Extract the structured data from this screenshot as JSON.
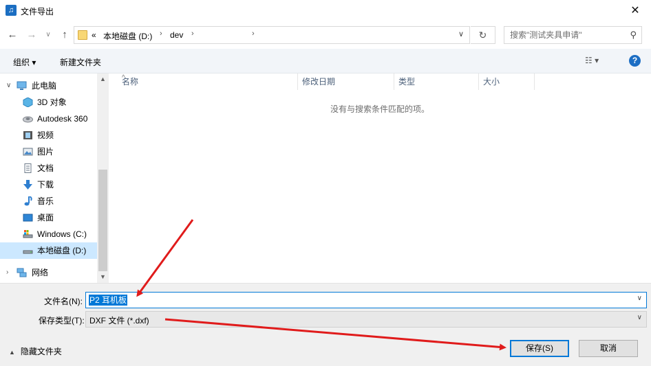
{
  "window": {
    "title": "文件导出",
    "close_glyph": "✕"
  },
  "nav": {
    "back": "←",
    "forward": "→",
    "recent": "∨",
    "up": "↑",
    "breadcrumb": [
      {
        "label": "«"
      },
      {
        "label": "本地磁盘 (D:)"
      },
      {
        "label": "dev"
      }
    ],
    "separator": "›",
    "refresh": "↻",
    "search_placeholder": "搜索\"测试夹具申请\""
  },
  "toolbar": {
    "organize": "组织 ▾",
    "new_folder": "新建文件夹",
    "view": "☷ ▾",
    "help": "?"
  },
  "sidebar": {
    "items": [
      {
        "label": "此电脑",
        "icon": "this-pc-icon"
      },
      {
        "label": "3D 对象",
        "icon": "3d-objects-icon"
      },
      {
        "label": "Autodesk 360",
        "icon": "autodesk-360-icon"
      },
      {
        "label": "视频",
        "icon": "videos-icon"
      },
      {
        "label": "图片",
        "icon": "pictures-icon"
      },
      {
        "label": "文档",
        "icon": "documents-icon"
      },
      {
        "label": "下载",
        "icon": "downloads-icon"
      },
      {
        "label": "音乐",
        "icon": "music-icon"
      },
      {
        "label": "桌面",
        "icon": "desktop-icon"
      },
      {
        "label": "Windows (C:)",
        "icon": "drive-c-icon"
      },
      {
        "label": "本地磁盘 (D:)",
        "icon": "drive-d-icon",
        "selected": true
      },
      {
        "label": "网络",
        "icon": "network-icon"
      }
    ]
  },
  "filelist": {
    "columns": [
      "名称",
      "修改日期",
      "类型",
      "大小"
    ],
    "empty_message": "没有与搜索条件匹配的项。"
  },
  "form": {
    "filename_label": "文件名(N):",
    "filename_value": "P2 耳机板",
    "filetype_label": "保存类型(T):",
    "filetype_value": "DXF 文件 (*.dxf)"
  },
  "footer": {
    "hide_folders": "隐藏文件夹",
    "save": "保存(S)",
    "cancel": "取消"
  },
  "colors": {
    "accent": "#0078d7",
    "arrow": "#e01b1b",
    "selected_bg": "#cce8ff"
  }
}
